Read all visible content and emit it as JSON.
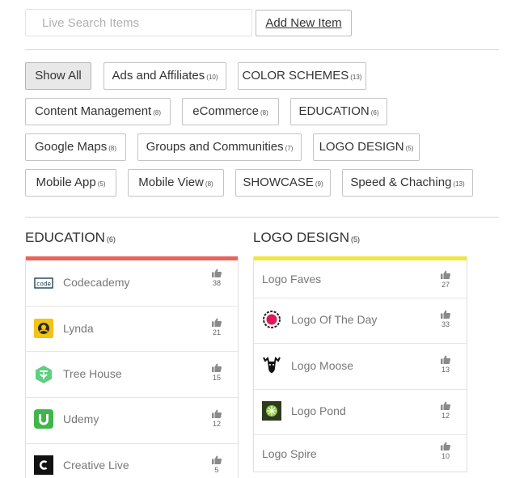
{
  "search": {
    "placeholder": "Live Search Items"
  },
  "add_button": {
    "label": "Add New Item"
  },
  "filters": {
    "row1": [
      {
        "label": "Show All",
        "count": ""
      },
      {
        "label": "Ads and Affiliates",
        "count": "(10)"
      },
      {
        "label": "COLOR SCHEMES",
        "count": "(13)"
      }
    ],
    "row2": [
      {
        "label": "Content Management",
        "count": "(8)"
      },
      {
        "label": "eCommerce",
        "count": "(8)"
      },
      {
        "label": "EDUCATION",
        "count": "(6)"
      }
    ],
    "row3": [
      {
        "label": "Google Maps",
        "count": "(8)"
      },
      {
        "label": "Groups and Communities",
        "count": "(7)"
      },
      {
        "label": "LOGO DESIGN",
        "count": "(5)"
      }
    ],
    "row4": [
      {
        "label": "Mobile App",
        "count": "(5)"
      },
      {
        "label": "Mobile View",
        "count": "(8)"
      },
      {
        "label": "SHOWCASE",
        "count": "(9)"
      },
      {
        "label": "Speed & Chaching",
        "count": "(13)"
      }
    ]
  },
  "columns": {
    "education": {
      "title": "EDUCATION",
      "count": "(6)",
      "accent": "#e8645a",
      "items": [
        {
          "name": "Codecademy",
          "votes": "38",
          "icon": "codecademy-logo"
        },
        {
          "name": "Lynda",
          "votes": "21",
          "icon": "lynda-logo"
        },
        {
          "name": "Tree House",
          "votes": "15",
          "icon": "treehouse-logo"
        },
        {
          "name": "Udemy",
          "votes": "12",
          "icon": "udemy-logo"
        },
        {
          "name": "Creative Live",
          "votes": "5",
          "icon": "creativelive-logo"
        }
      ]
    },
    "logo_design": {
      "title": "LOGO DESIGN",
      "count": "(5)",
      "accent": "#f1e540",
      "items": [
        {
          "name": "Logo Faves",
          "votes": "27",
          "icon": ""
        },
        {
          "name": "Logo Of The Day",
          "votes": "33",
          "icon": "logooftheday-logo"
        },
        {
          "name": "Logo Moose",
          "votes": "13",
          "icon": "logomoose-logo"
        },
        {
          "name": "Logo Pond",
          "votes": "12",
          "icon": "logopond-logo"
        },
        {
          "name": "Logo Spire",
          "votes": "10",
          "icon": ""
        }
      ]
    }
  }
}
